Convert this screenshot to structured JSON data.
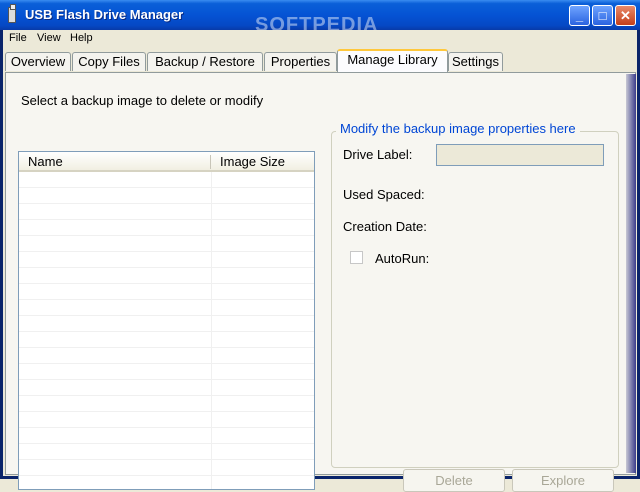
{
  "window": {
    "title": "USB Flash Drive Manager",
    "watermark": "SOFTPEDIA",
    "controls": {
      "minimize": "_",
      "maximize": "□",
      "close": "✕"
    }
  },
  "menu": {
    "items": [
      "File",
      "View",
      "Help"
    ]
  },
  "tabs": [
    {
      "label": "Overview"
    },
    {
      "label": "Copy Files"
    },
    {
      "label": "Backup / Restore"
    },
    {
      "label": "Properties"
    },
    {
      "label": "Manage Library",
      "active": true
    },
    {
      "label": "Settings"
    }
  ],
  "library": {
    "prompt": "Select a backup image to delete or modify",
    "columns": [
      "Name",
      "Image Size"
    ],
    "rows": []
  },
  "properties": {
    "group_title": "Modify the backup image properties here",
    "drive_label": "Drive Label:",
    "drive_label_value": "",
    "used_space": "Used Spaced:",
    "creation_date": "Creation Date:",
    "autorun": "AutoRun:",
    "autorun_checked": false
  },
  "buttons": {
    "delete": "Delete",
    "explore": "Explore"
  },
  "colors": {
    "accent": "#0046d5",
    "active_tab": "#ffc83c",
    "title_bar": "#0553d4"
  }
}
